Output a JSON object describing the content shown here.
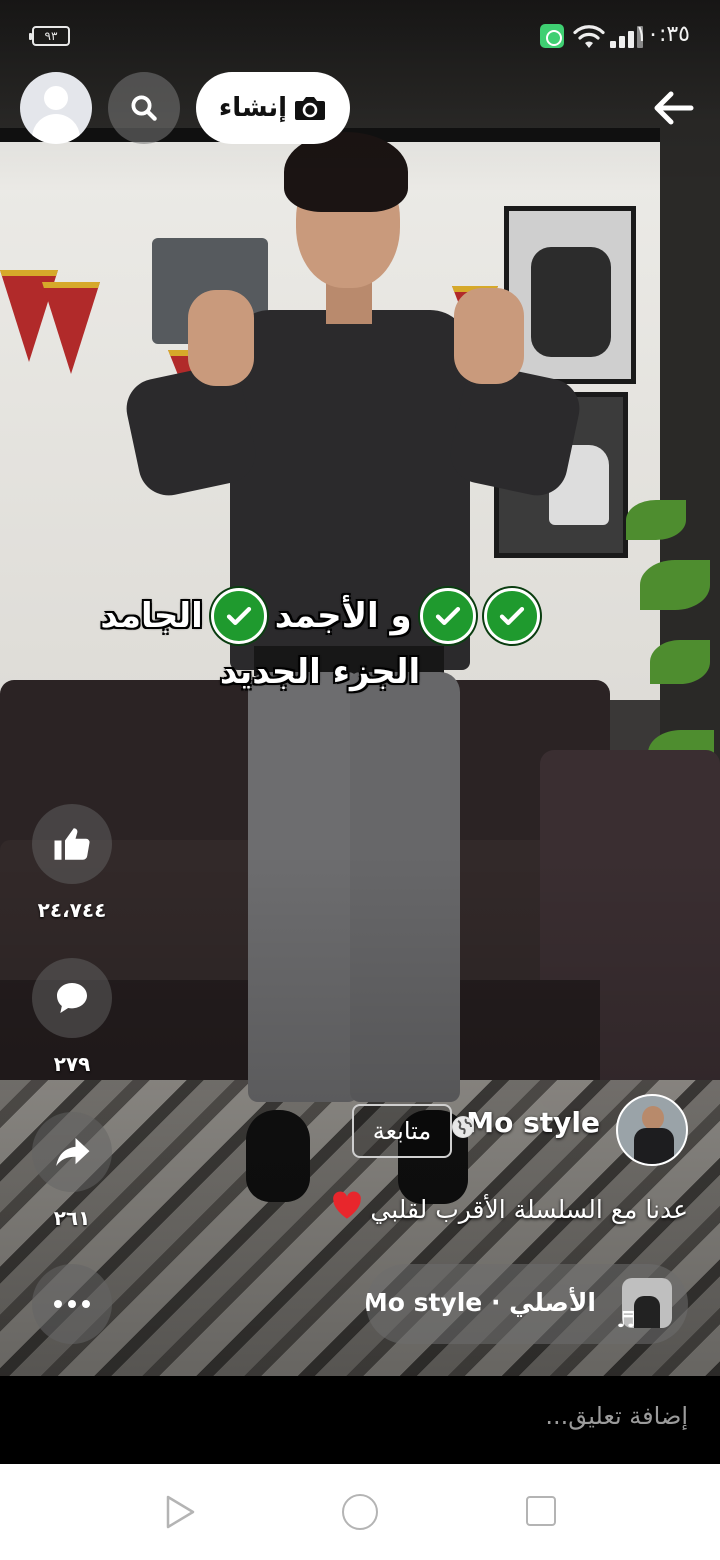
{
  "status_bar": {
    "time": "١٠:٣٥",
    "battery": "٩٣",
    "icons": [
      "app-notification-icon",
      "wifi-icon",
      "cellular-signal-icon"
    ]
  },
  "top_bar": {
    "create_label": "إنشاء",
    "icons": [
      "profile-avatar-icon",
      "search-icon",
      "camera-icon",
      "back-arrow-icon"
    ]
  },
  "video": {
    "caption_line1": {
      "part1": "الجامد",
      "part2": "و الأجمد"
    },
    "caption_line2": "الجزء الجديد",
    "check_icon_count": 3
  },
  "actions": {
    "like_count": "٢٤،٧٤٤",
    "comment_count": "٢٧٩",
    "share_count": "٢٦١"
  },
  "author": {
    "name": "Mo style",
    "follow_label": "متابعة"
  },
  "post": {
    "text": "عدنا مع السلسلة الأقرب لقلبي"
  },
  "audio": {
    "text": "الأصلي · Mo style"
  },
  "comment": {
    "placeholder": "إضافة تعليق..."
  },
  "colors": {
    "check_green": "#1f9a2e",
    "heart_red": "#e8262c",
    "background": "#000000",
    "nav_background": "#ffffff"
  }
}
